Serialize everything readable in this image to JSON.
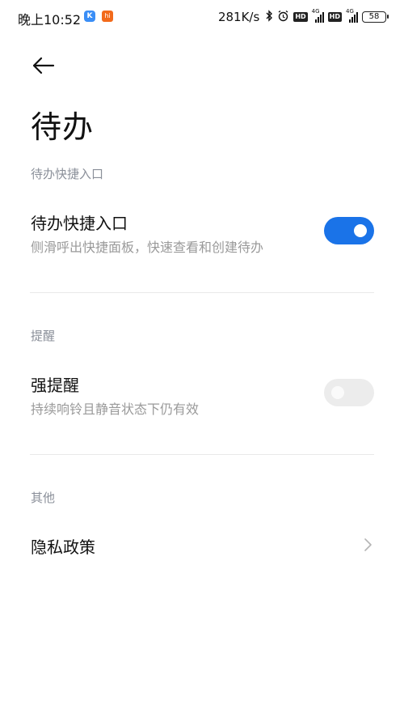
{
  "status_bar": {
    "time": "晚上10:52",
    "app1_glyph": "K",
    "app2_glyph": "hi",
    "net_speed": "281K/s",
    "network_label_1": "4G",
    "network_label_2": "4G",
    "hd_label": "HD",
    "battery": "58",
    "icons": [
      "bluetooth-icon",
      "alarm-icon",
      "hd-icon",
      "signal-icon",
      "battery-icon"
    ]
  },
  "header": {
    "back_icon": "back-arrow-icon",
    "title": "待办"
  },
  "sections": {
    "quick_entry": {
      "label": "待办快捷入口",
      "item_title": "待办快捷入口",
      "item_subtitle": "侧滑呼出快捷面板，快速查看和创建待办",
      "toggle_on": true
    },
    "reminder": {
      "label": "提醒",
      "item_title": "强提醒",
      "item_subtitle": "持续响铃且静音状态下仍有效",
      "toggle_on": false
    },
    "other": {
      "label": "其他",
      "item_title": "隐私政策",
      "chevron_icon": "chevron-right-icon"
    }
  },
  "colors": {
    "accent": "#1a73e8",
    "section_label": "#8a8f99",
    "subtitle": "#9a9a9a",
    "toggle_off": "#ececec"
  }
}
